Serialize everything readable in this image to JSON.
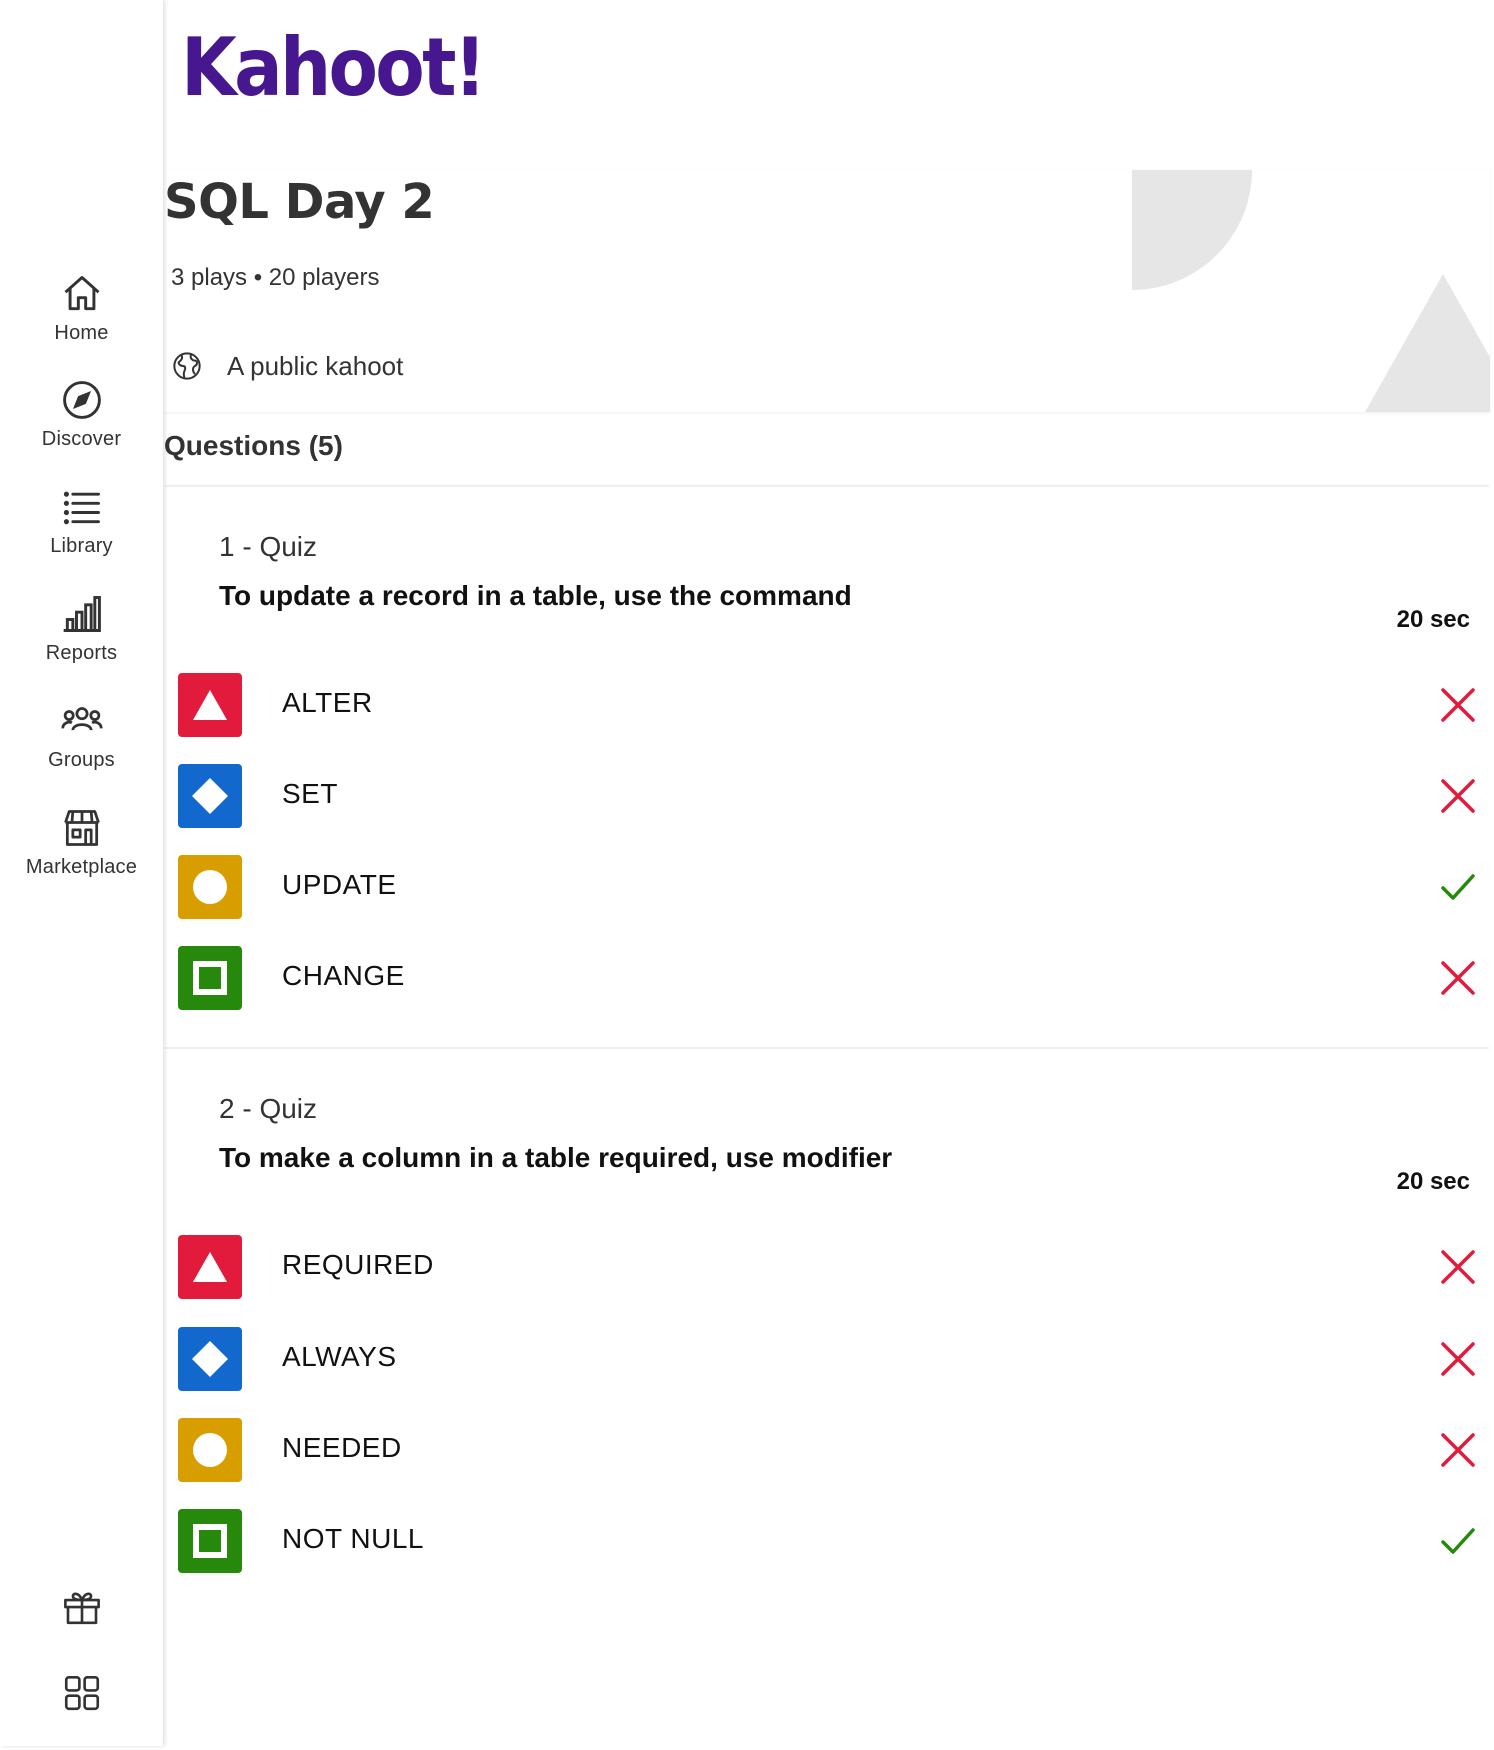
{
  "brand": {
    "logo_text": "Kahoot!",
    "logo_color": "#46178f"
  },
  "sidebar": {
    "items": [
      {
        "label": "Home",
        "icon": "home-icon"
      },
      {
        "label": "Discover",
        "icon": "compass-icon"
      },
      {
        "label": "Library",
        "icon": "list-icon"
      },
      {
        "label": "Reports",
        "icon": "bar-chart-icon"
      },
      {
        "label": "Groups",
        "icon": "groups-icon"
      },
      {
        "label": "Marketplace",
        "icon": "store-icon"
      }
    ],
    "bottom_icons": [
      "gift-icon",
      "apps-grid-icon"
    ]
  },
  "kahoot": {
    "title": "SQL Day 2",
    "stats": "3 plays • 20 players",
    "visibility": "A public kahoot"
  },
  "questions_heading": "Questions (5)",
  "questions": [
    {
      "type": "1 - Quiz",
      "text": "To update a record in a table, use the command",
      "time": "20 sec",
      "answers": [
        {
          "text": "ALTER",
          "shape": "triangle",
          "correct": false
        },
        {
          "text": "SET",
          "shape": "diamond",
          "correct": false
        },
        {
          "text": "UPDATE",
          "shape": "circle",
          "correct": true
        },
        {
          "text": "CHANGE",
          "shape": "square",
          "correct": false
        }
      ]
    },
    {
      "type": "2 - Quiz",
      "text": "To make a column in a table required, use modifier",
      "time": "20 sec",
      "answers": [
        {
          "text": "REQUIRED",
          "shape": "triangle",
          "correct": false
        },
        {
          "text": "ALWAYS",
          "shape": "diamond",
          "correct": false
        },
        {
          "text": "NEEDED",
          "shape": "circle",
          "correct": false
        },
        {
          "text": "NOT NULL",
          "shape": "square",
          "correct": true
        }
      ]
    }
  ],
  "colors": {
    "red": "#e21b3c",
    "blue": "#1368ce",
    "yellow": "#d89e00",
    "green": "#26890c",
    "incorrect_mark": "#e21b3c",
    "correct_mark": "#26890c"
  }
}
